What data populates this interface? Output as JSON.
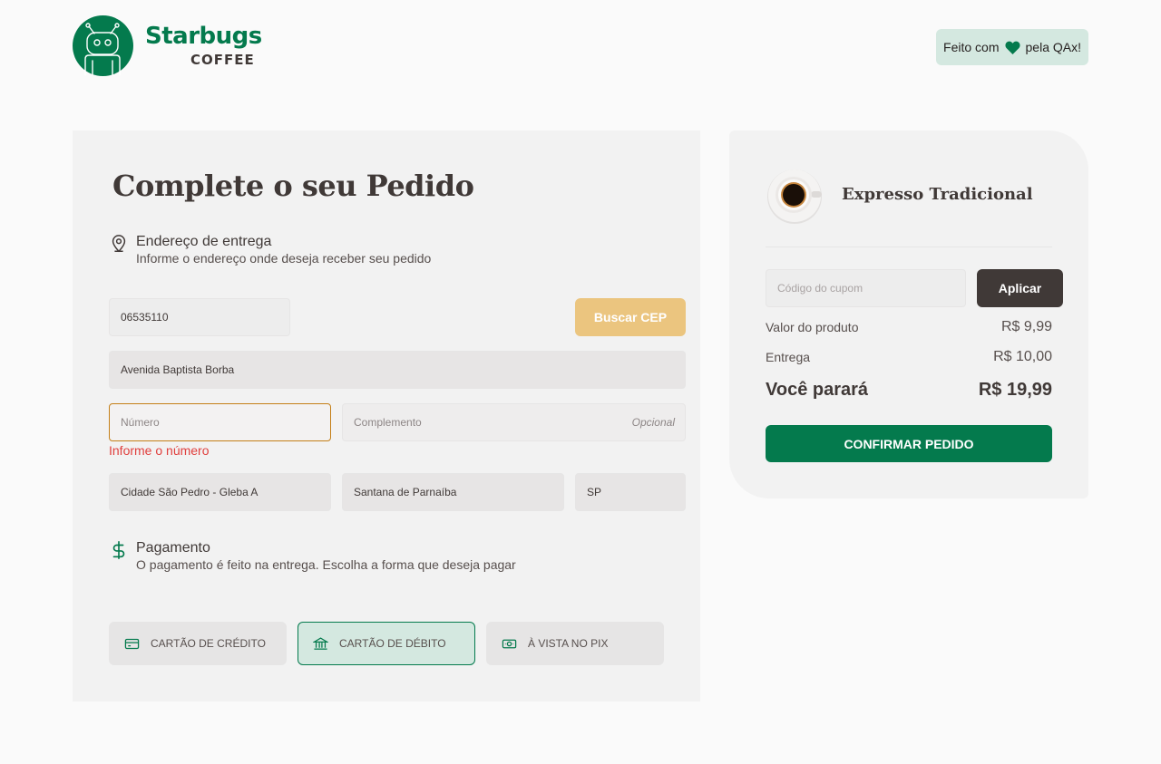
{
  "header": {
    "brand_name": "Starbugs",
    "brand_sub": "COFFEE",
    "made_with_prefix": "Feito com",
    "made_with_suffix": "pela QAx!",
    "brand_color": "#047a4d"
  },
  "checkout": {
    "title": "Complete o seu Pedido",
    "address_section": {
      "icon": "map-pin-icon",
      "title": "Endereço de entrega",
      "subtitle": "Informe o endereço onde deseja receber seu pedido"
    },
    "cep": {
      "value": "06535110"
    },
    "search_cep_label": "Buscar CEP",
    "street": {
      "value": "Avenida Baptista Borba"
    },
    "number": {
      "placeholder": "Número",
      "error": "Informe o número"
    },
    "complement": {
      "placeholder": "Complemento",
      "optional_label": "Opcional"
    },
    "district": {
      "value": "Cidade São Pedro - Gleba A"
    },
    "city": {
      "value": "Santana de Parnaíba"
    },
    "state": {
      "value": "SP"
    },
    "payment_section": {
      "icon": "dollar-icon",
      "title": "Pagamento",
      "subtitle": "O pagamento é feito na entrega. Escolha a forma que deseja pagar"
    },
    "payment_options": [
      {
        "label": "CARTÃO DE CRÉDITO",
        "icon": "credit-card-icon",
        "selected": false
      },
      {
        "label": "CARTÃO DE DÉBITO",
        "icon": "bank-icon",
        "selected": true
      },
      {
        "label": "À VISTA NO PIX",
        "icon": "money-icon",
        "selected": false
      }
    ]
  },
  "cart": {
    "product_name": "Expresso Tradicional",
    "coupon_placeholder": "Código do cupom",
    "apply_label": "Aplicar",
    "product_value_label": "Valor do produto",
    "product_value": "R$ 9,99",
    "delivery_label": "Entrega",
    "delivery_value": "R$ 10,00",
    "total_label": "Você parará",
    "total_value": "R$ 19,99",
    "confirm_label": "CONFIRMAR PEDIDO"
  }
}
